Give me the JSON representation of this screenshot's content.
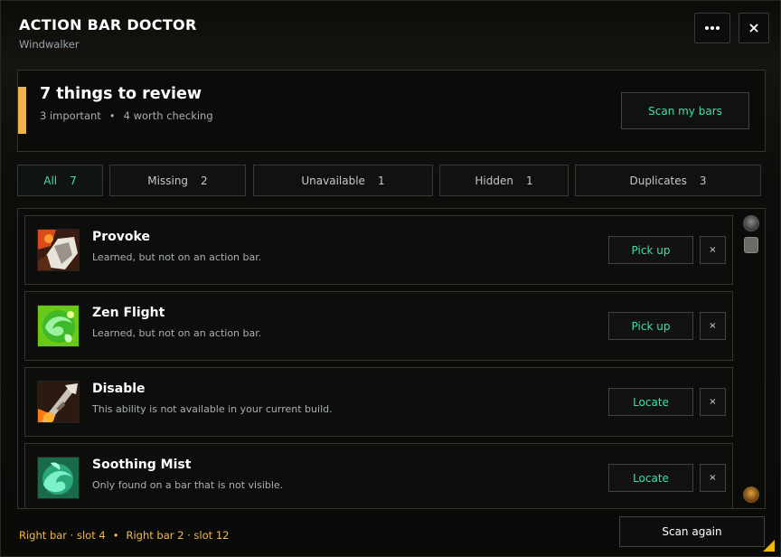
{
  "window": {
    "title": "ACTION BAR DOCTOR",
    "subtitle": "Windwalker",
    "more_icon": "ellipsis-icon",
    "close_icon": "close-icon"
  },
  "summary": {
    "title": "7 things to review",
    "important": "3 important",
    "separator": "•",
    "worth_checking": "4 worth checking",
    "scan_button": "Scan my bars",
    "accent_color": "#f0b34a"
  },
  "tabs": [
    {
      "label": "All",
      "count": "7",
      "active": true
    },
    {
      "label": "Missing",
      "count": "2",
      "active": false
    },
    {
      "label": "Unavailable",
      "count": "1",
      "active": false
    },
    {
      "label": "Hidden",
      "count": "1",
      "active": false
    },
    {
      "label": "Duplicates",
      "count": "3",
      "active": false
    }
  ],
  "items": [
    {
      "name": "Provoke",
      "desc": "Learned, but not on an action bar.",
      "action": "Pick up",
      "dismiss": "×",
      "icon": "provoke-spell-icon"
    },
    {
      "name": "Zen Flight",
      "desc": "Learned, but not on an action bar.",
      "action": "Pick up",
      "dismiss": "×",
      "icon": "zen-flight-spell-icon"
    },
    {
      "name": "Disable",
      "desc": "This ability is not available in your current build.",
      "action": "Locate",
      "dismiss": "×",
      "icon": "disable-spell-icon"
    },
    {
      "name": "Soothing Mist",
      "desc": "Only found on a bar that is not visible.",
      "action": "Locate",
      "dismiss": "×",
      "icon": "soothing-mist-spell-icon"
    }
  ],
  "footer": {
    "loc1": "Right bar · slot 4",
    "sep": "•",
    "loc2": "Right bar 2 · slot 12",
    "scan_again": "Scan again"
  },
  "colors": {
    "accent_green": "#3fe0a4",
    "accent_gold": "#f2b84e"
  }
}
